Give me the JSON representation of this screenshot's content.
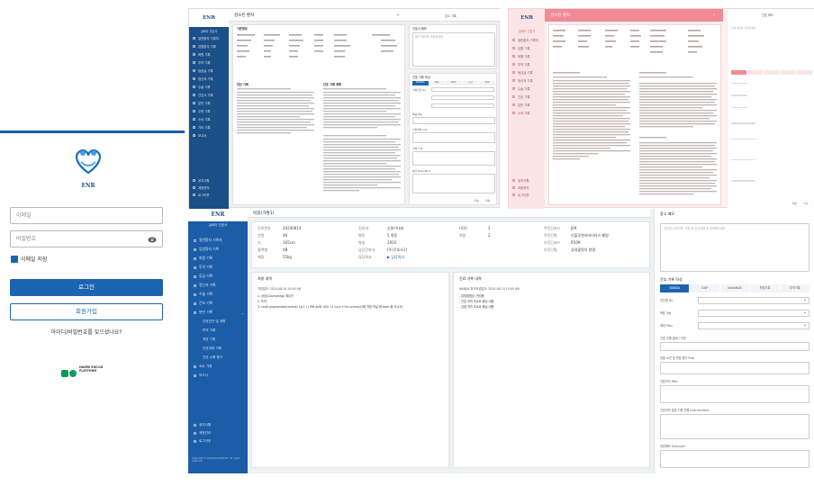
{
  "login": {
    "logo_caption": "ENR",
    "email_placeholder": "이메일",
    "password_placeholder": "비밀번호",
    "remember_label": "이메일 저장",
    "login_button": "로그인",
    "signup_button": "회원가입",
    "forgot_text": "아이디/비밀번호를 잊으셨나요?",
    "partner_logo": "HANMI EUCLID PLATFORM"
  },
  "screen_a": {
    "logo": "ENR",
    "sidebar_header": "실비아 간호사",
    "title": "검소된 환자",
    "panel_title": "검소 기록",
    "section_basic": "기본정보",
    "section_diag": "진단 기록",
    "section_nursing": "간호 기록 계획",
    "right_title": "간호사 메모",
    "memo_placeholder": "환자 메모를 작성하세요",
    "nursing_rec_title": "간호 기록 작성",
    "tabs": [
      "NANDA",
      "NIC",
      "NOC",
      "진단",
      "처치"
    ],
    "fields": [
      "간호진단 Dx",
      "목표 Obj",
      "간호계획 Intv",
      "간호 수행",
      "평가 Evaluation"
    ],
    "buttons": [
      "취소",
      "저장"
    ],
    "sidebar_items": [
      "일반환자 기록지",
      "입원환자 기록",
      "퇴원 기록",
      "투약 기록",
      "응급실 기록",
      "정신과 기록",
      "수술 기록",
      "간호사 기록",
      "분만 기록",
      "수면 기록",
      "소아 기록",
      "기타 기록",
      "보고서"
    ],
    "sidebar_footer": [
      "공지사항",
      "계정관리",
      "로그아웃"
    ]
  },
  "screen_b": {
    "logo": "ENR",
    "sidebar_header": "실비아 간호사",
    "title": "검소된 환자",
    "sidebar_items": [
      "일반환자 기록지",
      "입원 기록",
      "퇴원 기록",
      "투약 기록",
      "응급실 기록",
      "정신과 기록",
      "수술 기록",
      "간호 기록",
      "분만 기록",
      "소아 기록"
    ],
    "sidebar_footer": [
      "공지사항",
      "계정관리",
      "로그아웃"
    ],
    "right_title": "간호 메모",
    "right_placeholder": "간호 메모를 작성하세요",
    "right_buttons": [
      "취소",
      "저장"
    ]
  },
  "screen_c": {
    "logo": "ENR",
    "sidebar_header": "실비아 간호사",
    "title": "박길(가명1)",
    "right_panel_title": "참고 메모",
    "memo_placeholder": "진단명 소견기록, 처방 및 검사내용 등 입력해주세요",
    "nursing_title": "간호 기록 작성",
    "tabs": [
      "NANDA",
      "ICNP",
      "NoSoNDA",
      "처방기록",
      "투약기록"
    ],
    "form_fields": [
      "진단명 Dx",
      "목표 Obj",
      "계획 Plan",
      "간호 수행 결과 / 의견",
      "관찰 소견 및 판정 평가 Eval",
      "간호처치 Plan",
      "간호처치 결과 기록 진행 Interventions",
      "관련메모 Exclusion"
    ],
    "info_rows": [
      {
        "label": "진료번호",
        "value": "20240814"
      },
      {
        "label": "연령",
        "value": "48"
      },
      {
        "label": "키",
        "value": "165cm"
      },
      {
        "label": "혈액형",
        "value": "AB"
      },
      {
        "label": "체중",
        "value": "55kg"
      }
    ],
    "info_rows2": [
      {
        "label": "진료과",
        "value": "순환기내과"
      },
      {
        "label": "병동",
        "value": "5 병동"
      },
      {
        "label": "병실",
        "value": "1003"
      },
      {
        "label": "담당간호사",
        "value": "[주)간호사1]"
      },
      {
        "label": "담당의사",
        "value": "▶ 담당의사"
      }
    ],
    "info_rows3": [
      {
        "label": "HDD",
        "value": "2"
      },
      {
        "label": "처방",
        "value": "2"
      }
    ],
    "info_rows4": [
      {
        "label": "주진단코드",
        "value": "J09"
      },
      {
        "label": "주진단명",
        "value": "인플루엔자바이러스 폐렴"
      },
      {
        "label": "부진단코드",
        "value": "R509"
      },
      {
        "label": "부진단명",
        "value": "상세불명의 발열"
      }
    ],
    "sidebar_items": [
      "일반환자 기록지",
      "입원환자 기록",
      "퇴원 기록",
      "투약 기록",
      "응급 기록",
      "정신과 기록",
      "수술 기록",
      "간호 기록",
      "분만 기록",
      "소아 기록"
    ],
    "sub_items": [
      "간호진단 및 계획",
      "투약 기록",
      "처방 기록",
      "간호과정 기록",
      "간호 수행 평가",
      "보고서"
    ],
    "sidebar_footer": [
      "공지사항",
      "계정관리",
      "로그아웃"
    ],
    "copyright": "Copyright © 2024 EUCLIDSOFT. All rights reserved.",
    "left_card_title": "처방 내역",
    "left_card_date": "처방일자: 2024-08-14 10:00 AM",
    "left_card_lines": [
      "1. 상담(Counseling) 최우선",
      "2. 투약",
      "3. cardi propranolol(control) 1g 1 시 IPN 4x/8 10hr 11 cure 5 hrs urinary(3회 처방 하실 때 each 회 쓰시오)"
    ],
    "right_card_title": "진료 기록 내역",
    "right_card_date": "NANDA 최초작성일자: 2024-08-14 10:00 AM",
    "right_card_lines": [
      "- 감염위험성: 관리중",
      "- 간호 처치 미소요 중심 내원",
      "- 감염 처치 미소요 중심 내원"
    ]
  }
}
